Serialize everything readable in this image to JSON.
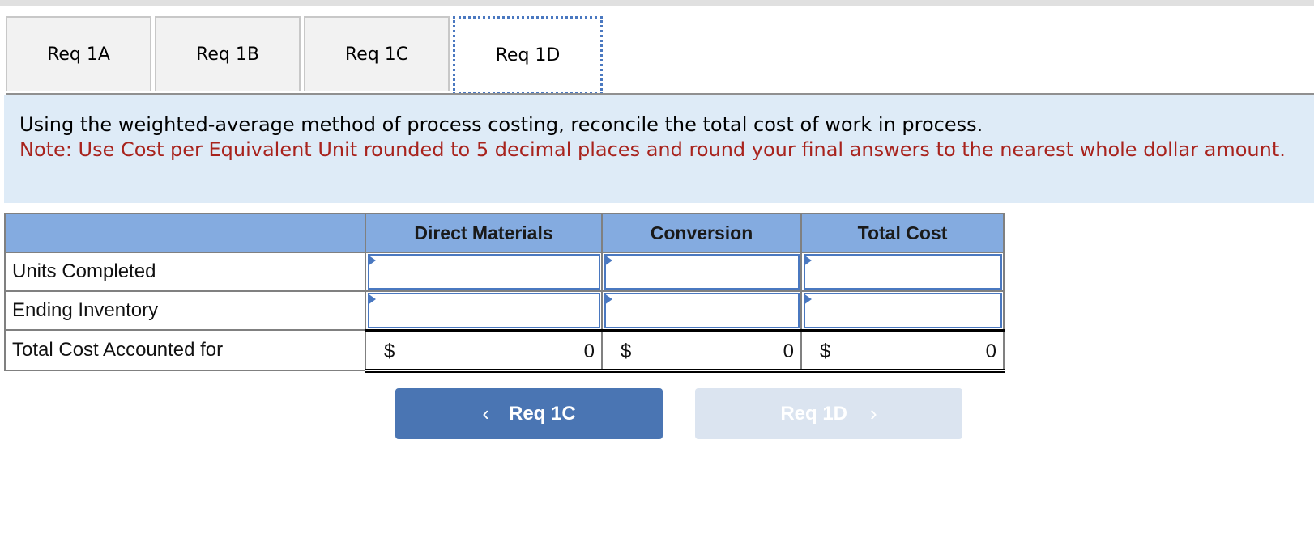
{
  "tabs": [
    {
      "label": "Req 1A",
      "active": false
    },
    {
      "label": "Req 1B",
      "active": false
    },
    {
      "label": "Req 1C",
      "active": false
    },
    {
      "label": "Req 1D",
      "active": true
    }
  ],
  "instructions": {
    "main": "Using the weighted-average method of process costing, reconcile the total cost of work in process.",
    "note": "Note: Use Cost per Equivalent Unit rounded to 5 decimal places and round your final answers to the nearest whole dollar amount."
  },
  "table": {
    "headers": [
      "",
      "Direct Materials",
      "Conversion",
      "Total Cost"
    ],
    "rows": [
      {
        "label": "Units Completed",
        "values": [
          "",
          "",
          ""
        ]
      },
      {
        "label": "Ending Inventory",
        "values": [
          "",
          "",
          ""
        ]
      }
    ],
    "total_row": {
      "label": "Total Cost Accounted for",
      "currency": "$",
      "values": [
        "0",
        "0",
        "0"
      ]
    }
  },
  "nav": {
    "prev_label": "Req 1C",
    "next_label": "Req 1D",
    "prev_icon": "chevron-left-icon",
    "next_icon": "chevron-right-icon",
    "prev_glyph": "‹",
    "next_glyph": "›"
  }
}
